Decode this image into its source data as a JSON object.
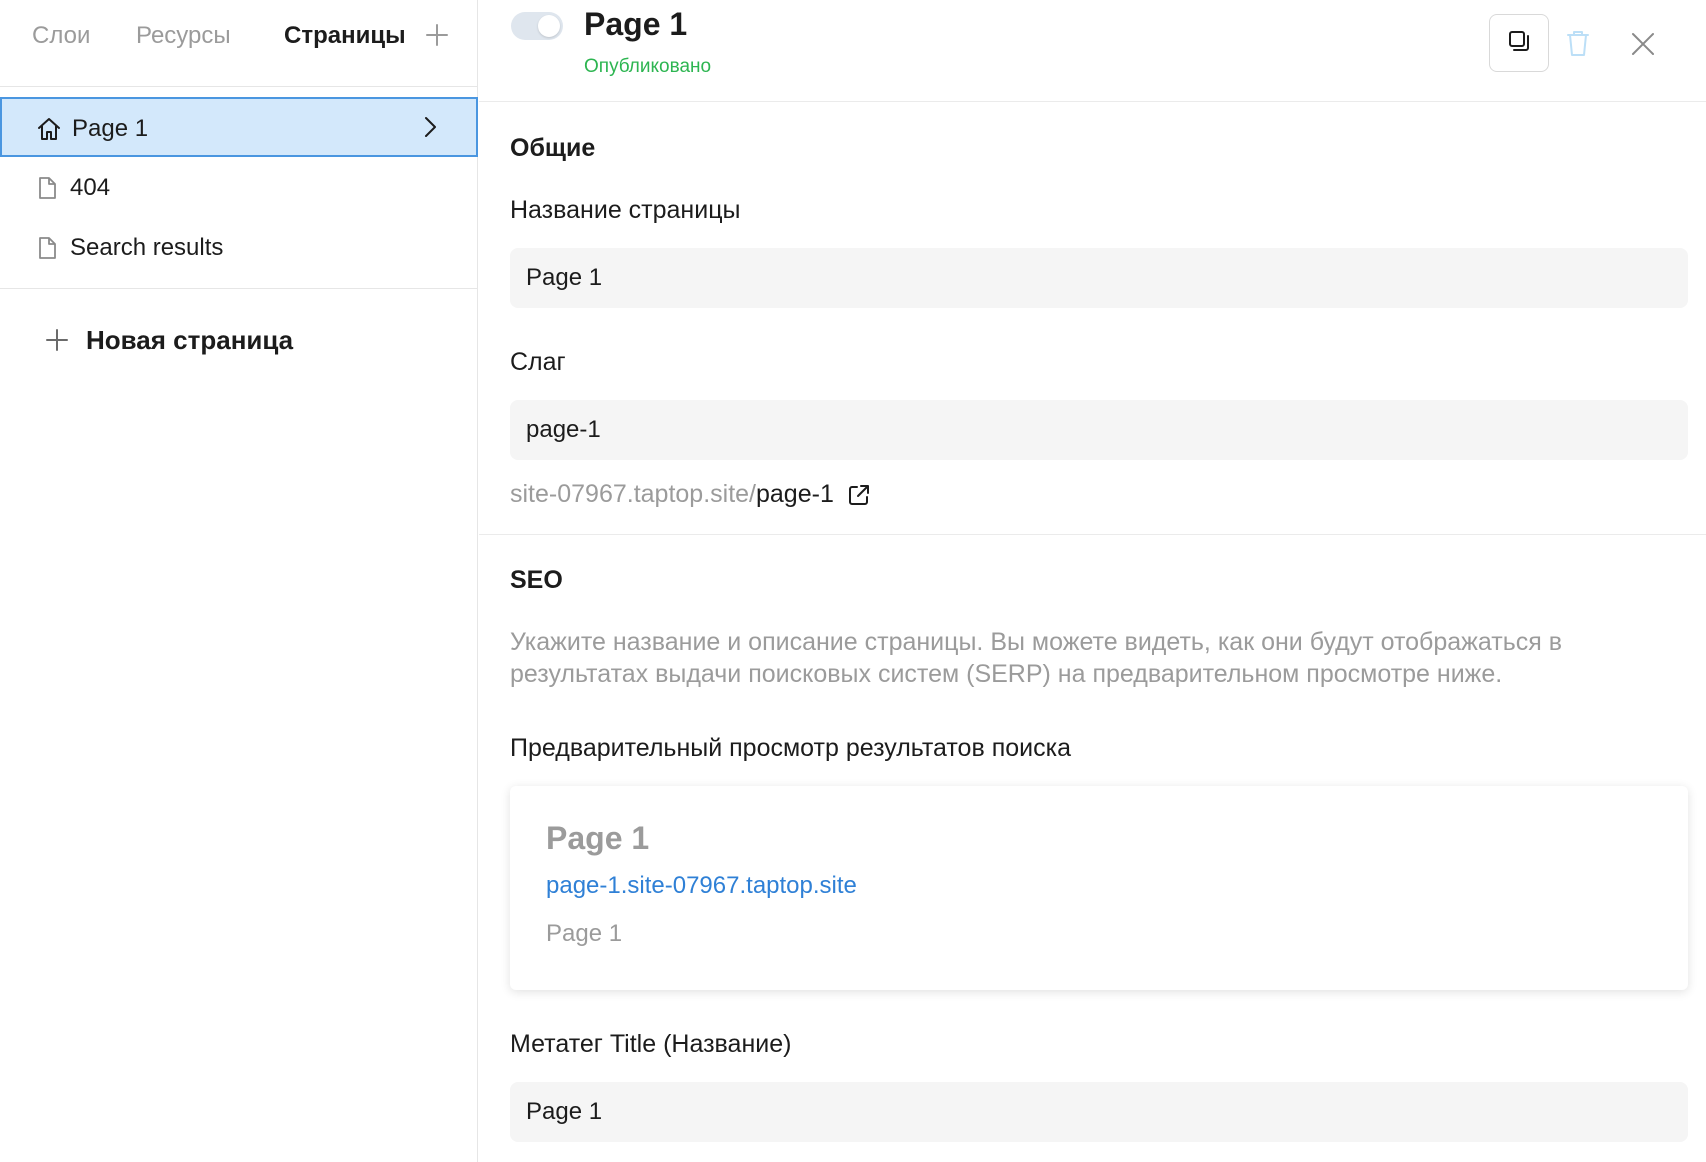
{
  "sidebar": {
    "tabs": [
      {
        "label": "Слои",
        "active": false
      },
      {
        "label": "Ресурсы",
        "active": false
      },
      {
        "label": "Страницы",
        "active": true
      }
    ],
    "pages": [
      {
        "label": "Page 1",
        "icon": "home-icon",
        "selected": true
      },
      {
        "label": "404",
        "icon": "file-icon",
        "selected": false
      },
      {
        "label": "Search results",
        "icon": "file-icon",
        "selected": false
      }
    ],
    "new_page_label": "Новая страница"
  },
  "header": {
    "title": "Page 1",
    "status": "Опубликовано",
    "published": true
  },
  "general": {
    "section_title": "Общие",
    "page_name_label": "Название страницы",
    "page_name_value": "Page 1",
    "slug_label": "Слаг",
    "slug_value": "page-1",
    "url_base": "site-07967.taptop.site/",
    "url_path": "page-1"
  },
  "seo": {
    "section_title": "SEO",
    "description": "Укажите название и описание страницы. Вы можете видеть, как они будут отображаться в результатах выдачи поисковых систем (SERP) на предварительном просмотре ниже.",
    "preview_label": "Предварительный просмотр результатов поиска",
    "preview": {
      "title": "Page 1",
      "url": "page-1.site-07967.taptop.site",
      "description": "Page 1"
    },
    "meta_title_label": "Метатег Title (Название)",
    "meta_title_value": "Page 1"
  },
  "colors": {
    "accent": "#4a96e0",
    "selected_bg": "#d3e8fb",
    "status_green": "#2db551",
    "link_blue": "#2f80d6"
  }
}
